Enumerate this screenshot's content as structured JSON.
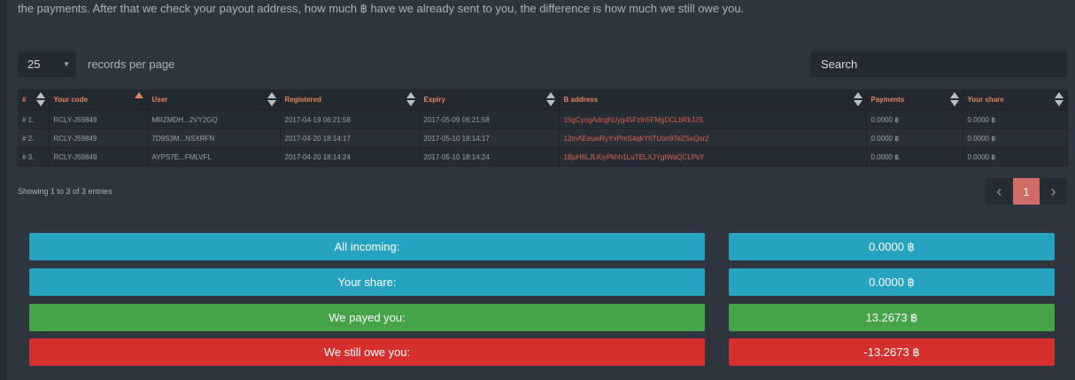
{
  "intro_text": "the payments. After that we check your payout address, how much ฿ have we already sent to you, the difference is how much we still owe you.",
  "length_select": {
    "value": "25",
    "label": "records per page"
  },
  "search": {
    "placeholder": "Search"
  },
  "table": {
    "columns": [
      "#",
      "Your code",
      "User",
      "Registered",
      "Expiry",
      "B address",
      "Payments",
      "Your share"
    ],
    "sorted_column": "Your code",
    "rows": [
      [
        "# 1.",
        "RCLY-J59849",
        "MRZMDH...2VY2GQ",
        "2017-04-19 06:21:58",
        "2017-05-09 06:21:58",
        "15gCyogAdcghUyg45Fzfn5FMgDCLbRkJJS",
        "0.0000 ฿",
        "0.0000 ฿"
      ],
      [
        "# 2.",
        "RCLY-J59849",
        "7D9S3M...NSXRFN",
        "2017-04-20 18:14:17",
        "2017-05-10 18:14:17",
        "12mAEeuwRyYxPmS4qkYhTUon9TeZSxQsr2",
        "0.0000 ฿",
        "0.0000 ฿"
      ],
      [
        "# 3.",
        "RCLY-J59849",
        "AYPS7E...FMLVFL",
        "2017-04-20 18:14:24",
        "2017-05-10 18:14:24",
        "1BpH6LJLKiyPkhh1LuTELXJYgtWaQCLPsY",
        "0.0000 ฿",
        "0.0000 ฿"
      ]
    ]
  },
  "info": "Showing 1 to 3 of 3 entries",
  "pagination": {
    "prev": "‹",
    "current": "1",
    "next": "›"
  },
  "summary": {
    "incoming": {
      "label": "All incoming:",
      "value": "0.0000 ฿"
    },
    "share": {
      "label": "Your share:",
      "value": "0.0000 ฿"
    },
    "payed": {
      "label": "We payed you:",
      "value": "13.2673 ฿"
    },
    "owe": {
      "label": "We still owe you:",
      "value": "-13.2673 ฿"
    }
  },
  "colors": {
    "blue": "#27a3c2",
    "green": "#45a447",
    "red": "#d5302e",
    "accent": "#e2845a",
    "address": "#d9624f"
  }
}
